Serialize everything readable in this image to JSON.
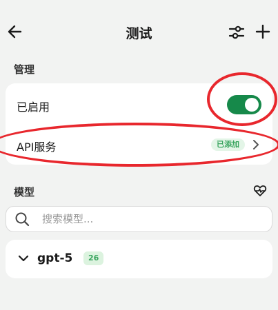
{
  "header": {
    "title": "测试"
  },
  "sections": {
    "manage_label": "管理",
    "models_label": "模型"
  },
  "manage": {
    "enabled_label": "已启用",
    "enabled": true,
    "api_label": "API服务",
    "api_status": "已添加"
  },
  "search": {
    "placeholder": "搜索模型...",
    "value": ""
  },
  "model_group": {
    "name": "gpt-5",
    "count": "26"
  },
  "colors": {
    "accent": "#16894a",
    "badge_bg": "#dcf3df",
    "badge_text": "#3aa55f",
    "annotation": "#e8272d",
    "background": "#f2f3f2"
  },
  "icons": {
    "back": "arrow-left-icon",
    "filter": "sliders-icon",
    "add": "plus-icon",
    "heart": "heart-pulse-icon",
    "search": "search-icon",
    "chevron_right": "chevron-right-icon",
    "chevron_down": "chevron-down-icon"
  }
}
